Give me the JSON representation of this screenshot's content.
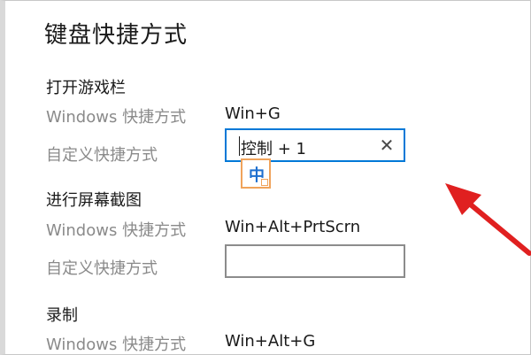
{
  "page": {
    "title": "键盘快捷方式"
  },
  "sections": [
    {
      "title": "打开游戏栏",
      "windows_label": "Windows 快捷方式",
      "windows_value": "Win+G",
      "custom_label": "自定义快捷方式",
      "custom_value": "控制 + 1"
    },
    {
      "title": "进行屏幕截图",
      "windows_label": "Windows 快捷方式",
      "windows_value": "Win+Alt+PrtScrn",
      "custom_label": "自定义快捷方式",
      "custom_value": ""
    },
    {
      "title": "录制",
      "windows_label": "Windows 快捷方式",
      "windows_value": "Win+Alt+G"
    }
  ],
  "ime_indicator": {
    "char": "中",
    "border_color": "#f0a35b",
    "text_color": "#1e6fcf"
  },
  "clear_icon": "close-icon",
  "colors": {
    "focus_border": "#0078d7",
    "annotation_arrow": "#e02020"
  }
}
